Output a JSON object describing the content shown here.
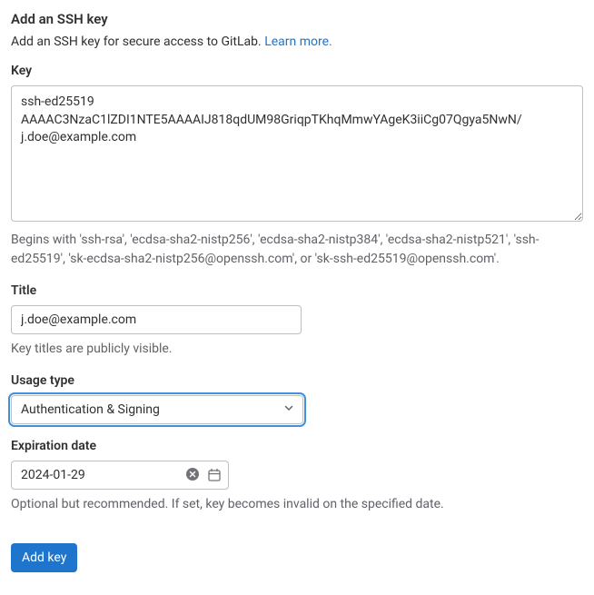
{
  "heading": "Add an SSH key",
  "description_text": "Add an SSH key for secure access to GitLab. ",
  "learn_more": "Learn more.",
  "key": {
    "label": "Key",
    "value": "ssh-ed25519 AAAAC3NzaC1lZDI1NTE5AAAAIJ818qdUM98GriqpTKhqMmwYAgeK3iiCg07Qgya5NwN/ j.doe@example.com",
    "help": "Begins with 'ssh-rsa', 'ecdsa-sha2-nistp256', 'ecdsa-sha2-nistp384', 'ecdsa-sha2-nistp521', 'ssh-ed25519', 'sk-ecdsa-sha2-nistp256@openssh.com', or 'sk-ssh-ed25519@openssh.com'."
  },
  "title": {
    "label": "Title",
    "value": "j.doe@example.com",
    "help": "Key titles are publicly visible."
  },
  "usage": {
    "label": "Usage type",
    "selected": "Authentication & Signing"
  },
  "expiration": {
    "label": "Expiration date",
    "value": "2024-01-29",
    "help": "Optional but recommended. If set, key becomes invalid on the specified date."
  },
  "submit_label": "Add key"
}
